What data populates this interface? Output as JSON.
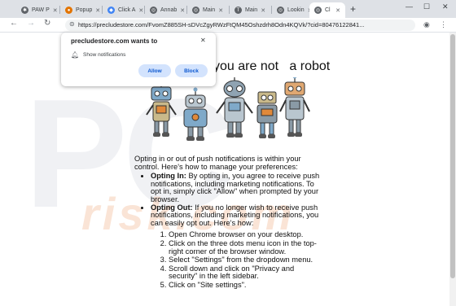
{
  "tabs": [
    {
      "label": "PAW P",
      "favicon": "paw-icon",
      "color": "#5f6368"
    },
    {
      "label": "Popup",
      "favicon": "popup-icon",
      "color": "#e37400"
    },
    {
      "label": "Click A",
      "favicon": "click-icon",
      "color": "#4285f4"
    },
    {
      "label": "Annab",
      "favicon": "globe-icon",
      "color": "#5f6368"
    },
    {
      "label": "Main",
      "favicon": "globe-icon",
      "color": "#5f6368"
    },
    {
      "label": "Main",
      "favicon": "t-icon",
      "color": "#5f6368"
    },
    {
      "label": "Lookin",
      "favicon": "globe-icon",
      "color": "#5f6368"
    },
    {
      "label": "Cl",
      "favicon": "globe-icon",
      "color": "#5f6368"
    }
  ],
  "toolbar": {
    "url": "https://precludestore.com/FvomZ885SH-sDVcZgyRWzFtQM45Oshzdrh8Odn4KQVk/?cid=80476122841..."
  },
  "popup": {
    "title": "precludestore.com wants to",
    "permission": "Show notifications",
    "allow_label": "Allow",
    "block_label": "Block"
  },
  "page": {
    "headline": "you are not   a robot",
    "intro": "Opting in or out of push notifications is within your control. Here's how to manage your preferences:",
    "opt_in_bold": "Opting In:",
    "opt_in_text": " By opting in, you agree to receive push notifications, including marketing notifications. To opt in, simply click \"Allow\" when prompted by your browser.",
    "opt_out_bold": "Opting Out:",
    "opt_out_text": " If you no longer wish to receive push notifications, including marketing notifications, you can easily opt out. Here's how:",
    "steps": [
      "Open Chrome browser on your desktop.",
      "Click on the three dots menu icon in the top-right corner of the browser window.",
      "Select \"Settings\" from the dropdown menu.",
      "Scroll down and click on \"Privacy and security\" in the left sidebar.",
      "Click on \"Site settings\"."
    ]
  },
  "watermark": {
    "main": "PC",
    "sub": "risk.com"
  }
}
